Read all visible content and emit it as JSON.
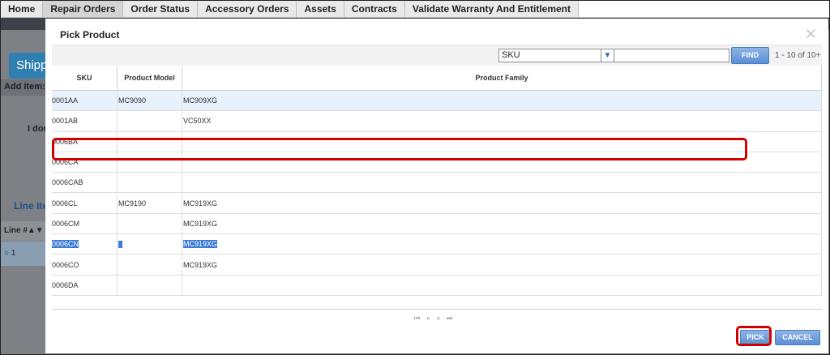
{
  "nav": {
    "items": [
      "Home",
      "Repair Orders",
      "Order Status",
      "Accessory Orders",
      "Assets",
      "Contracts",
      "Validate Warranty And Entitlement"
    ],
    "active_index": 1
  },
  "background": {
    "ship_button": "Shipp",
    "add_item": "Add Item:",
    "i_don": "I don",
    "line_items": "Line Ite",
    "line_no_header": "Line #▲▼",
    "row_value": "1"
  },
  "dialog": {
    "title": "Pick Product",
    "close_glyph": "✕",
    "search": {
      "field_selected": "SKU",
      "value": "",
      "find_label": "FIND",
      "result_count": "1 - 10 of 10+"
    },
    "columns": [
      "SKU",
      "Product Model",
      "Product Family"
    ],
    "rows": [
      {
        "sku": "0001AA",
        "model": "MC9090",
        "family": "MC909XG",
        "selected": true
      },
      {
        "sku": "0001AB",
        "model": "",
        "family": "VC50XX"
      },
      {
        "sku": "0006BA",
        "model": "",
        "family": ""
      },
      {
        "sku": "0006CA",
        "model": "",
        "family": ""
      },
      {
        "sku": "0006CAB",
        "model": "",
        "family": ""
      },
      {
        "sku": "0006CL",
        "model": "MC9190",
        "family": "MC919XG"
      },
      {
        "sku": "0006CM",
        "model": "",
        "family": "MC919XG"
      },
      {
        "sku": "0006CN",
        "model": "",
        "family": "MC919XG",
        "text_highlighted": true
      },
      {
        "sku": "0006CO",
        "model": "",
        "family": "MC919XG"
      },
      {
        "sku": "0006DA",
        "model": "",
        "family": ""
      }
    ],
    "pager": [
      "⏮",
      "«",
      "»",
      "⏭"
    ],
    "pick_label": "PICK",
    "cancel_label": "CANCEL"
  }
}
